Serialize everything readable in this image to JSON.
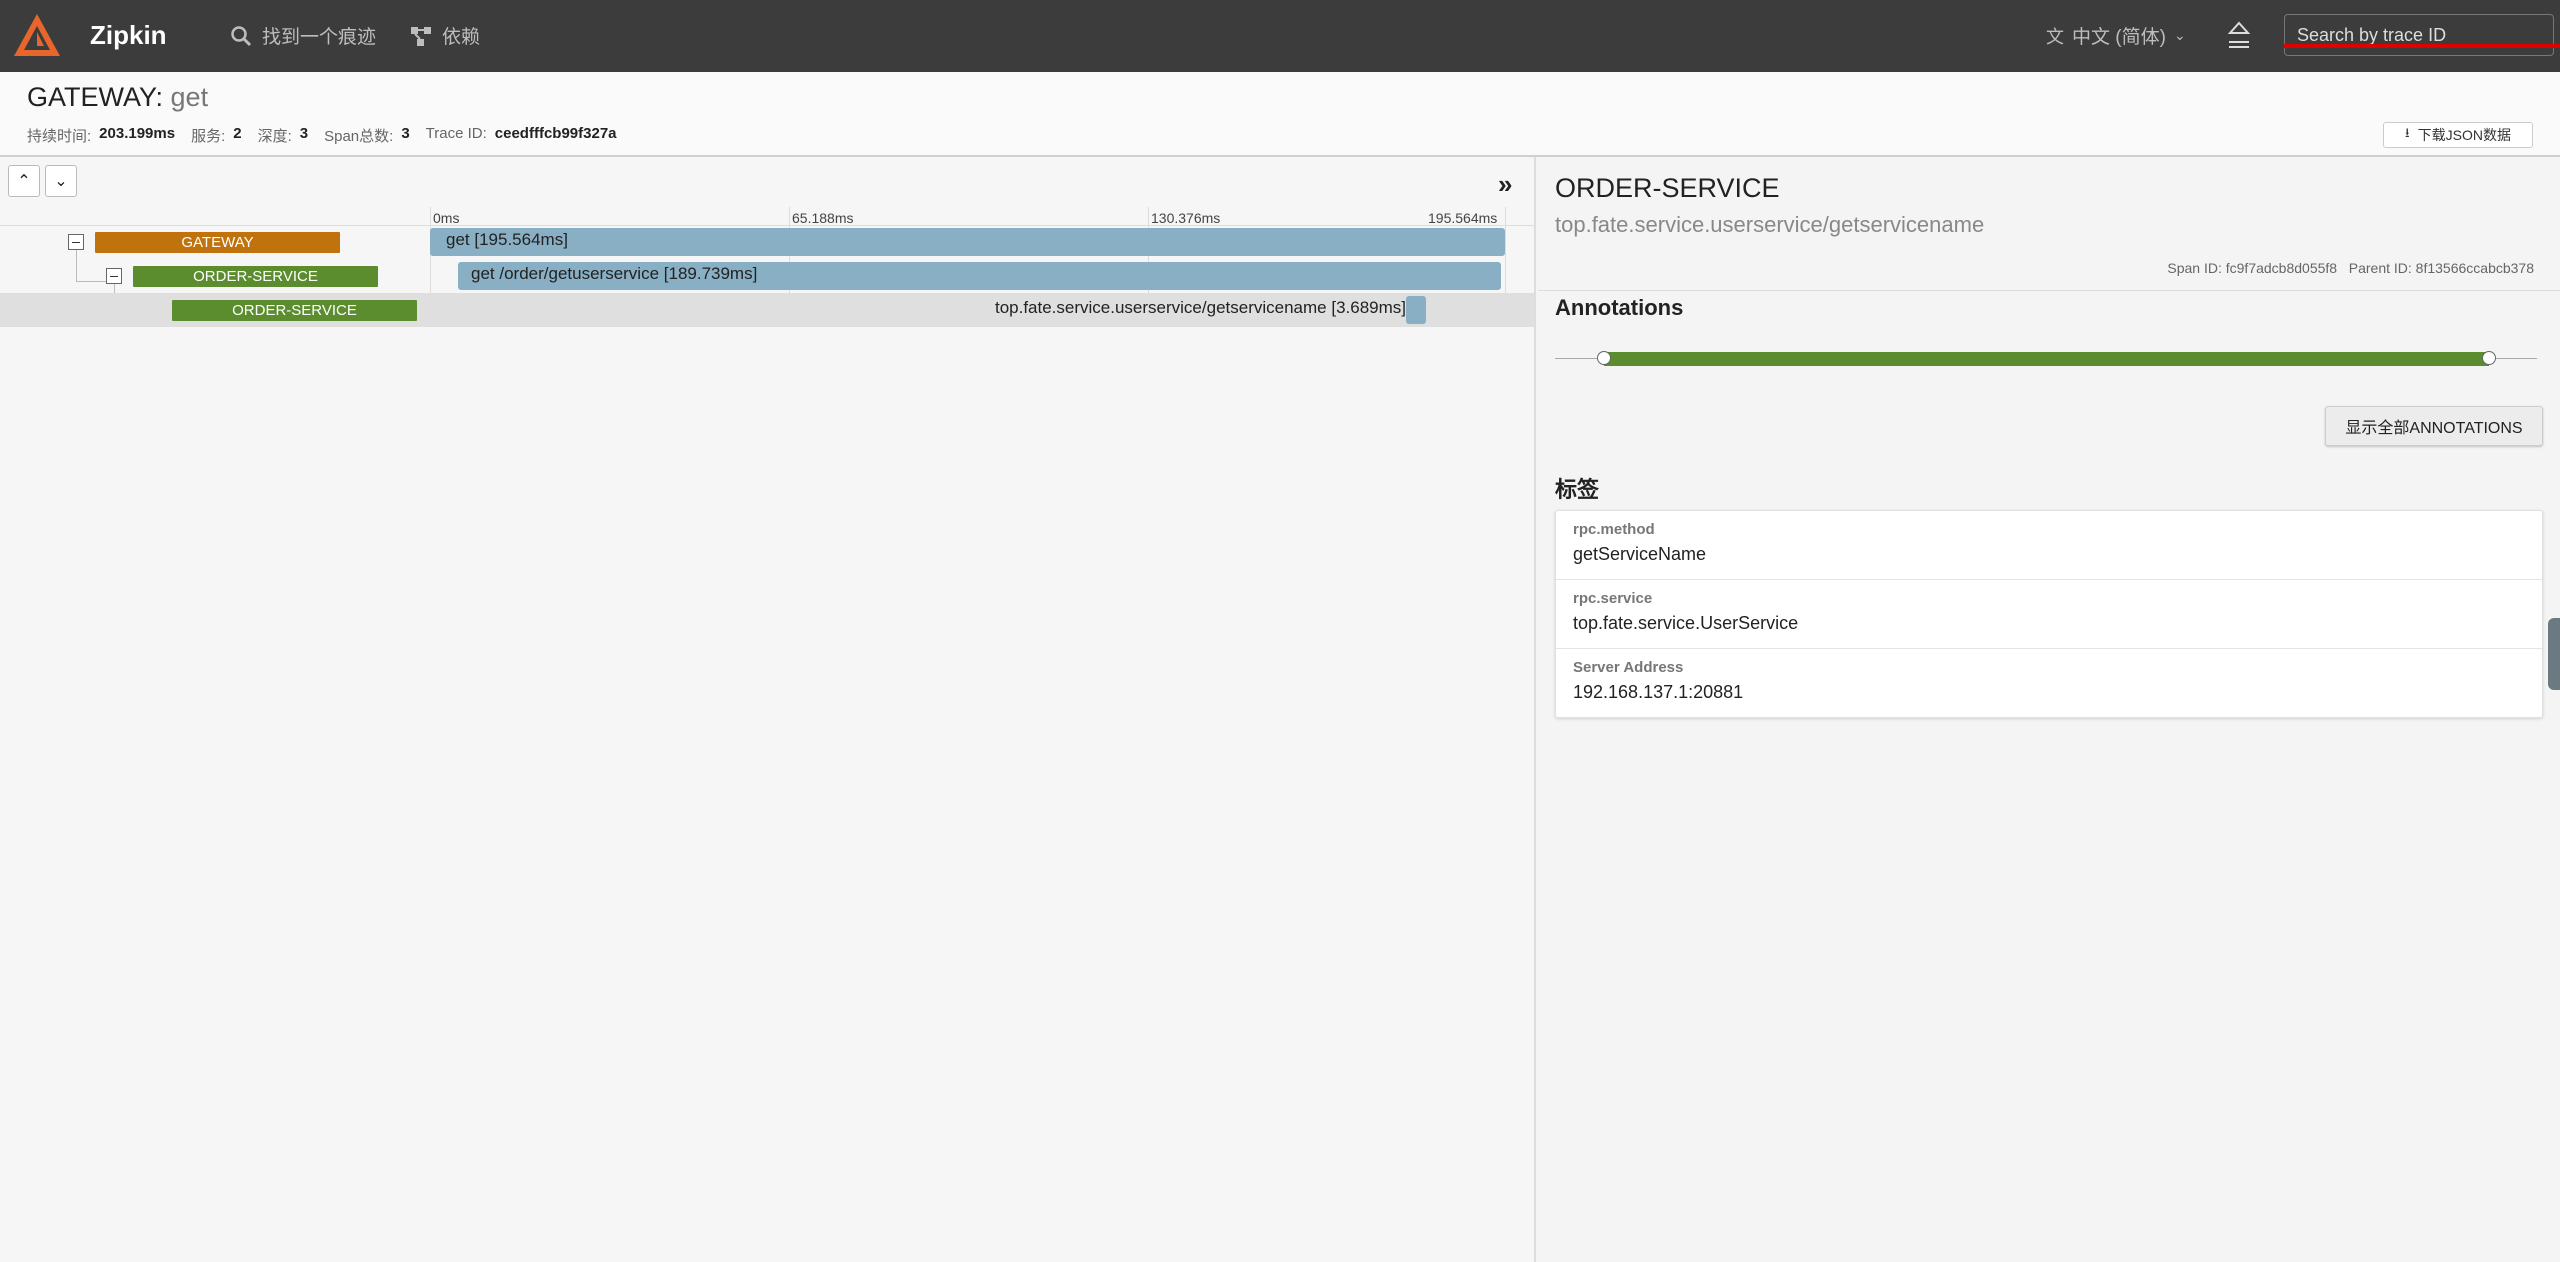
{
  "app": {
    "brand": "Zipkin",
    "colors": {
      "topbar": "#3c3c3c",
      "gateway": "#c0720d",
      "order_service": "#5b8c2d",
      "span_bar": "#88afc4",
      "annotation": "#5b8c2d"
    }
  },
  "nav": {
    "find_trace": "找到一个痕迹",
    "dependencies": "依赖",
    "language": "中文 (简体)",
    "search_placeholder": "Search by trace ID"
  },
  "trace": {
    "service": "GATEWAY",
    "sep": ": ",
    "operation": "get",
    "meta": {
      "duration_label": "持续时间:",
      "duration": "203.199ms",
      "services_label": "服务:",
      "services": "2",
      "depth_label": "深度:",
      "depth": "3",
      "spans_label": "Span总数:",
      "spans": "3",
      "trace_id_label": "Trace ID:",
      "trace_id": "ceedfffcb99f327a"
    },
    "download_label": "下载JSON数据"
  },
  "timeline": {
    "ticks": [
      "0ms",
      "65.188ms",
      "130.376ms",
      "195.564ms"
    ],
    "spans": [
      {
        "service": "GATEWAY",
        "label": "get [195.564ms]",
        "start_ms": 0,
        "duration_ms": 195.564
      },
      {
        "service": "ORDER-SERVICE",
        "label": "get /order/getuserservice [189.739ms]",
        "start_ms": 5.1,
        "duration_ms": 189.739
      },
      {
        "service": "ORDER-SERVICE",
        "label": "top.fate.service.userservice/getservicename [3.689ms]",
        "start_ms": 177.5,
        "duration_ms": 3.689
      }
    ]
  },
  "detail": {
    "service": "ORDER-SERVICE",
    "name": "top.fate.service.userservice/getservicename",
    "span_id_label": "Span ID:",
    "span_id": "fc9f7adcb8d055f8",
    "parent_id_label": "Parent ID:",
    "parent_id": "8f13566ccabcb378",
    "annotations_heading": "Annotations",
    "show_all_annotations": "显示全部ANNOTATIONS",
    "tags_heading": "标签",
    "tags": [
      {
        "key": "rpc.method",
        "value": "getServiceName"
      },
      {
        "key": "rpc.service",
        "value": "top.fate.service.UserService"
      },
      {
        "key": "Server Address",
        "value": "192.168.137.1:20881"
      }
    ]
  }
}
